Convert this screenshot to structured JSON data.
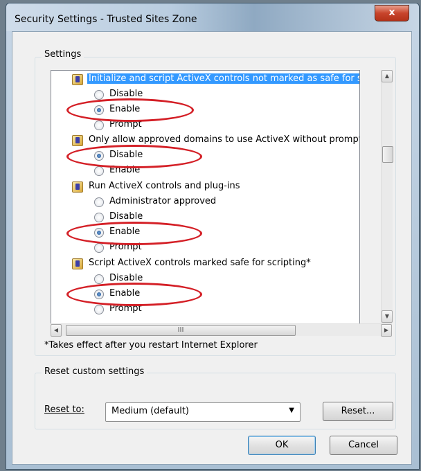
{
  "window": {
    "title": "Security Settings - Trusted Sites Zone",
    "close_glyph": "x"
  },
  "settings": {
    "group_label": "Settings",
    "items": [
      {
        "label": "Initialize and script ActiveX controls not marked as safe for sc",
        "options": [
          "Disable",
          "Enable",
          "Prompt"
        ],
        "selected": "Enable"
      },
      {
        "label": "Only allow approved domains to use ActiveX without prompt",
        "options": [
          "Disable",
          "Enable"
        ],
        "selected": "Disable"
      },
      {
        "label": "Run ActiveX controls and plug-ins",
        "options": [
          "Administrator approved",
          "Disable",
          "Enable",
          "Prompt"
        ],
        "selected": "Enable"
      },
      {
        "label": "Script ActiveX controls marked safe for scripting*",
        "options": [
          "Disable",
          "Enable",
          "Prompt"
        ],
        "selected": "Enable"
      }
    ],
    "hscroll_thumb_glyph": "III",
    "footnote": "*Takes effect after you restart Internet Explorer"
  },
  "reset": {
    "group_label": "Reset custom settings",
    "reset_to_label": "Reset to:",
    "selected_value": "Medium (default)",
    "reset_button": "Reset..."
  },
  "buttons": {
    "ok": "OK",
    "cancel": "Cancel"
  },
  "colors": {
    "highlight": "#3399ff",
    "annotation_circle": "#d41f26"
  }
}
